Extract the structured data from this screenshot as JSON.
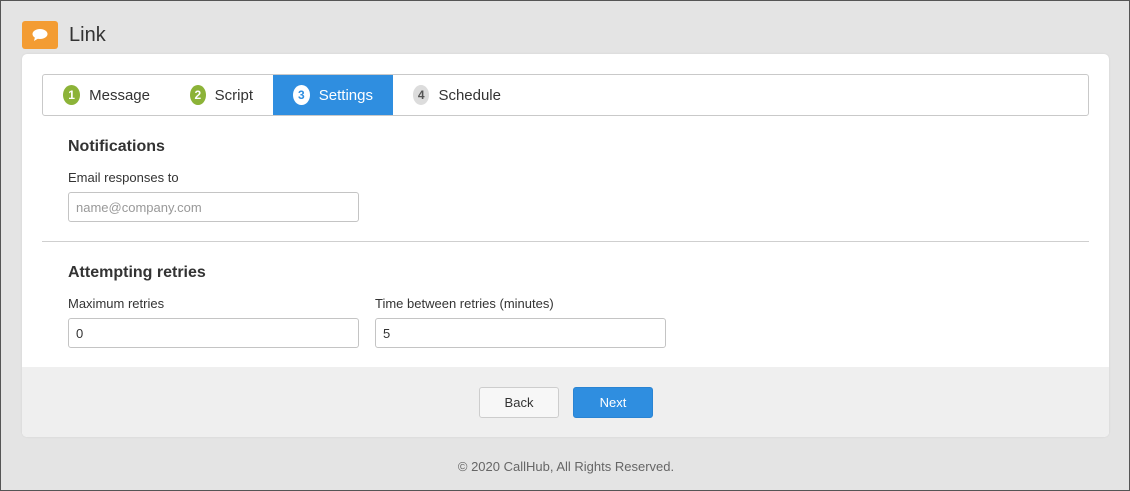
{
  "header": {
    "title": "Link",
    "logo_icon": "chat-bubble-icon",
    "accent": "#f39c33"
  },
  "steps": [
    {
      "num": "1",
      "label": "Message",
      "state": "done"
    },
    {
      "num": "2",
      "label": "Script",
      "state": "done"
    },
    {
      "num": "3",
      "label": "Settings",
      "state": "active"
    },
    {
      "num": "4",
      "label": "Schedule",
      "state": "todo"
    }
  ],
  "notifications": {
    "title": "Notifications",
    "email_label": "Email responses to",
    "email_value": "",
    "email_placeholder": "name@company.com"
  },
  "retries": {
    "title": "Attempting retries",
    "max_label": "Maximum retries",
    "max_value": "0",
    "interval_label": "Time between retries (minutes)",
    "interval_value": "5"
  },
  "actions": {
    "back_label": "Back",
    "next_label": "Next"
  },
  "footer": {
    "copyright": "© 2020 CallHub, All Rights Reserved."
  },
  "colors": {
    "primary": "#2f8ee0",
    "done": "#8cb338"
  }
}
